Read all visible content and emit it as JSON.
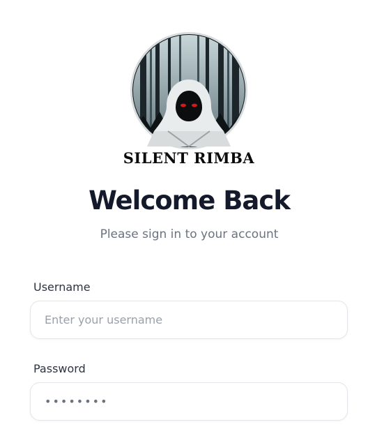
{
  "brand": {
    "logo_text": "SILENT RIMBA",
    "logo_icon": "hooded-figure-forest-logo"
  },
  "header": {
    "title": "Welcome Back",
    "subtitle": "Please sign in to your account"
  },
  "form": {
    "username": {
      "label": "Username",
      "placeholder": "Enter your username",
      "value": ""
    },
    "password": {
      "label": "Password",
      "placeholder": "",
      "value": "••••••••"
    }
  },
  "colors": {
    "title": "#141a2b",
    "subtitle": "#6b7280",
    "field_border": "#e3e5ea"
  }
}
